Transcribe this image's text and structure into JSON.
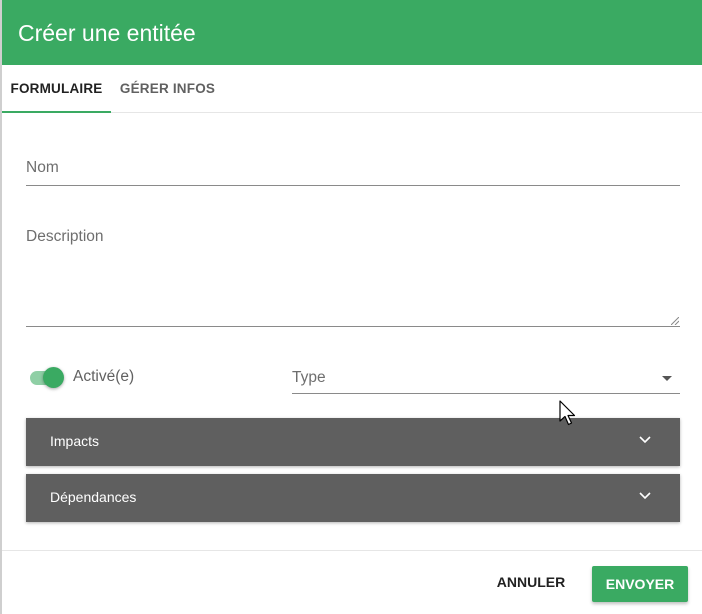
{
  "dialog": {
    "title": "Créer une entitée"
  },
  "tabs": [
    {
      "label": "FORMULAIRE",
      "active": true
    },
    {
      "label": "GÉRER INFOS",
      "active": false
    }
  ],
  "form": {
    "name": {
      "label": "Nom",
      "value": ""
    },
    "description": {
      "label": "Description",
      "value": ""
    },
    "enabled": {
      "label": "Activé(e)",
      "checked": true
    },
    "type": {
      "label": "Type",
      "value": ""
    }
  },
  "panels": [
    {
      "label": "Impacts",
      "icon": "chevron-down-icon"
    },
    {
      "label": "Dépendances",
      "icon": "chevron-down-icon"
    }
  ],
  "actions": {
    "cancel_label": "ANNULER",
    "submit_label": "ENVOYER"
  },
  "colors": {
    "accent": "#3aaa62",
    "panel": "#5f5f5f"
  }
}
